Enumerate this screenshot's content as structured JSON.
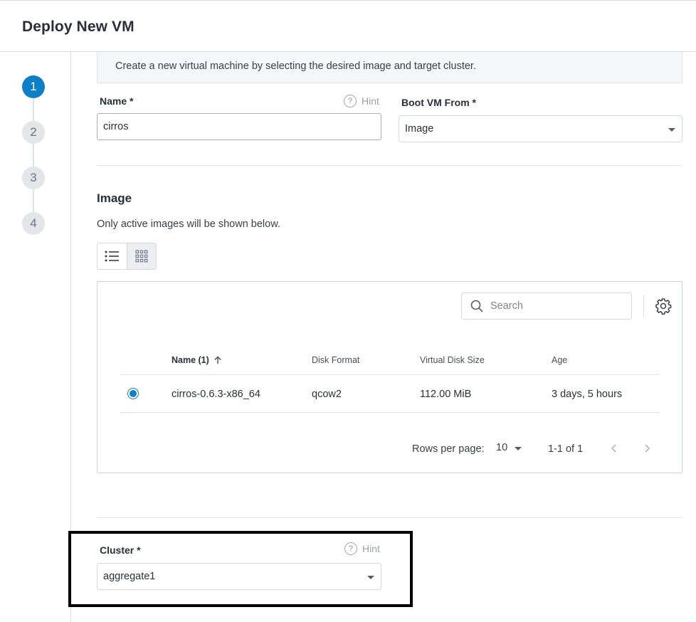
{
  "header": {
    "title": "Deploy New VM"
  },
  "stepper": {
    "steps": [
      "1",
      "2",
      "3",
      "4"
    ],
    "active_index": 0,
    "accent_color": "#0c7fc7"
  },
  "banner": {
    "text": "Create a new virtual machine by selecting the desired image and target cluster."
  },
  "form": {
    "name_label": "Name *",
    "name_value": "cirros",
    "hint_label": "Hint",
    "boot_label": "Boot VM From *",
    "boot_value": "Image"
  },
  "image_section": {
    "title": "Image",
    "subtitle": "Only active images will be shown below.",
    "view_modes": [
      "list-view-icon",
      "grid-view-icon"
    ],
    "active_view": "list"
  },
  "table": {
    "search_placeholder": "Search",
    "columns": [
      "Name (1)",
      "Disk Format",
      "Virtual Disk Size",
      "Age"
    ],
    "rows": [
      {
        "name": "cirros-0.6.3-x86_64",
        "disk_format": "qcow2",
        "size": "112.00 MiB",
        "age": "3 days, 5 hours",
        "selected": true
      }
    ],
    "pagination": {
      "rows_label": "Rows per page:",
      "rows_value": "10",
      "range": "1-1 of 1"
    }
  },
  "cluster": {
    "label": "Cluster *",
    "hint_label": "Hint",
    "value": "aggregate1"
  }
}
